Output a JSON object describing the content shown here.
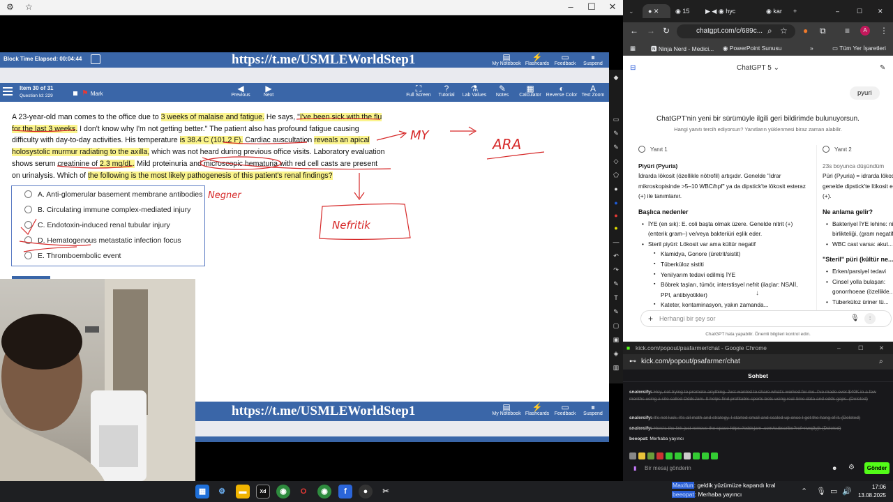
{
  "left_window": {
    "elapsed": "Block Time Elapsed: 00:04:44",
    "banner_url": "https://t.me/USMLEWorldStep1",
    "top_tools": [
      "My Notebook",
      "Flashcards",
      "Feedback",
      "Suspend"
    ],
    "item_label": "Item 30 of 31",
    "question_id": "Question Id: 229",
    "mark_label": "Mark",
    "nav": {
      "previous": "Previous",
      "next": "Next"
    },
    "nav_tools": [
      "Full Screen",
      "Tutorial",
      "Lab Values",
      "Notes",
      "Calculator",
      "Reverse Color",
      "Text Zoom"
    ],
    "stem": {
      "s1": "A 23-year-old man comes to the office due to ",
      "s2": "3 weeks of malaise and fatigue.",
      "s3": "  He says, \"",
      "s4": "I've been sick with the flu for the last 3 weeks.",
      "s5": "  I don't know why I'm not getting better.\"  The patient also has profound fatigue causing difficulty with day-to-day activities.  His temperature ",
      "s6": "is 38.4 C (101.2 F).",
      "s7": "  Cardiac auscultation ",
      "s8": "reveals an apical holosystolic murmur radiating to the axilla,",
      "s9": " which was not heard during previous office visits.  Laboratory evaluation shows serum creatinine of ",
      "s10": "2.3 mg/dL.",
      "s11": "  Mild proteinuria and microscopic hematuria with red cell casts are present on urinalysis.  Which of ",
      "s12": "the following is the most likely pathogenesis of this patient's renal findings?"
    },
    "answers": [
      {
        "letter": "A.",
        "text": "Anti-glomerular basement membrane antibodies"
      },
      {
        "letter": "B.",
        "text": "Circulating immune complex-mediated injury"
      },
      {
        "letter": "C.",
        "text": "Endotoxin-induced renal tubular injury"
      },
      {
        "letter": "D.",
        "text": "Hematogenous metastatic infection focus"
      },
      {
        "letter": "E.",
        "text": "Thromboembolic event"
      }
    ],
    "handwriting": [
      "MY",
      "ARA",
      "Nefritik",
      "Negner"
    ]
  },
  "chrome": {
    "tabs": [
      "15",
      "hyc",
      "kar"
    ],
    "url": "chatgpt.com/c/689c...",
    "bookmarks": [
      "Ninja Nerd - Medici...",
      "PowerPoint Sunusu",
      "Tüm Yer İşaretleri"
    ]
  },
  "chatgpt": {
    "title": "ChatGPT 5",
    "user_msg": "pyuri",
    "feedback_q": "ChatGPT'nin yeni bir sürümüyle ilgili geri bildirimde bulunuyorsun.",
    "feedback_sub": "Hangi yanıtı tercih ediyorsun? Yanıtların yüklenmesi biraz zaman alabilir.",
    "r1": {
      "label": "Yanıt 1",
      "heading": "Piyüri (Pyuria)",
      "intro": "İdrarda lökosit (özellikle nötrofil) artışıdır. Genelde \"idrar mikroskopisinde >5–10 WBC/hpf\" ya da dipstick'te lökosit esteraz (+) ile tanımlanır.",
      "sub": "Başlıca nedenler",
      "b1": "İYE (en sık): E. coli başta olmak üzere. Genelde nitrit (+) (enterik gram–) ve/veya bakteriüri eşlik eder.",
      "b2": "Steril piyüri: Lökosit var ama kültür negatif",
      "s1": "Klamidya, Gonore (üretrit/sistit)",
      "s2": "Tüberküloz sistiti",
      "s3": "Yeni/yarım tedavi edilmiş İYE",
      "s4": "Böbrek taşları, tümör, interstisyel nefrit (ilaçlar: NSAİİ, PPI, antibiyotikler)",
      "s5": "Kateter, kontaminasyon, yakın zamanda..."
    },
    "r2": {
      "label": "Yanıt 2",
      "thinking": "23s boyunca düşündüm",
      "intro": "Püri (Pyuria) = idrarda lökosit artışı; genelde dipstick'te lökosit esteraz (+).",
      "h1": "Ne anlama gelir?",
      "b1": "Bakteriyel İYE lehine: nitrit (+) birlikteliği, (gram negatifler).",
      "b2": "WBC cast varsa: akut...",
      "h2": "\"Steril\" püri (kültür ne...",
      "b3": "Erken/parsiyel tedavi",
      "b4": "Cinsel yolla bulaşan: gonorrhoeae (özellikle...",
      "b5": "Tüberküloz üriner tü..."
    },
    "composer_placeholder": "Herhangi bir şey sor",
    "disclaimer": "ChatGPT hata yapabilir. Önemli bilgileri kontrol edin."
  },
  "kick": {
    "window_title": "kick.com/popout/psafarmer/chat - Google Chrome",
    "url": "kick.com/popout/psafarmer/chat",
    "header": "Sohbet",
    "messages": [
      {
        "user": "snalersify:",
        "text": " Hey, not trying to promote anything. Just wanted to share what's worked for me. I've made over $40K in a few months using a site called OddsJam. It helps find profitable sports bets using real-time data and odds gaps. (Deleted)"
      },
      {
        "user": "snalersify:",
        "text": " It's not luck. It's all math and strategy. I started small and scaled up once I got the hang of it. (Deleted)"
      },
      {
        "user": "snalersify:",
        "text": " Here's the link just remove the space https://oddsjam .com/subscribe?ref=nwq3yjk (Deleted)"
      },
      {
        "user": "beeopat:",
        "text": " Merhaba yayıncı"
      }
    ],
    "input_placeholder": "Bir mesaj gönderin",
    "send": "Gönder"
  },
  "taskbar": {
    "toast_user1": "Maxifun",
    "toast_msg1": ": geldik yüzümüze kapandı kral",
    "toast_user2": "beeopat",
    "toast_msg2": ": Merhaba yayıncı",
    "time": "17:06",
    "date": "13.08.2025"
  }
}
